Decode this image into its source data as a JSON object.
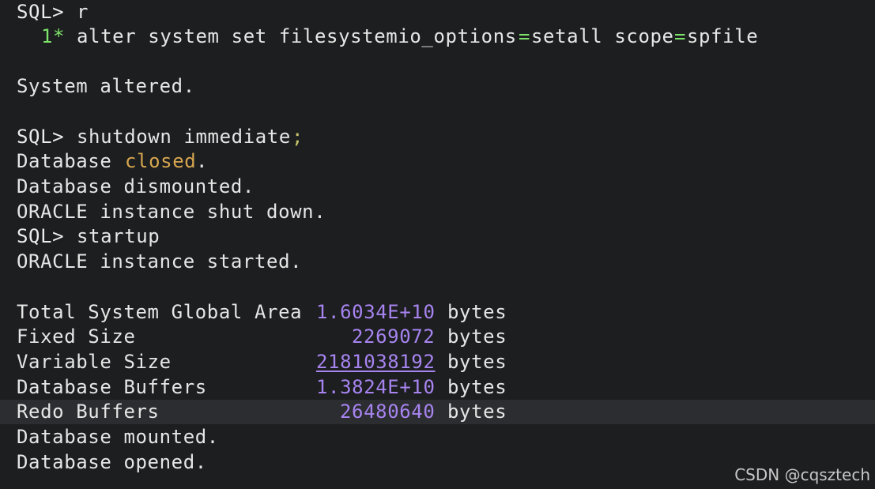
{
  "terminal": {
    "lines": {
      "l1": {
        "prompt": "SQL>",
        "cmd": "r"
      },
      "l2": {
        "num": "1*",
        "a": "alter system set filesystemio_options",
        "eq1": "=",
        "b": "setall scope",
        "eq2": "=",
        "c": "spfile"
      },
      "l3": {
        "text": "System altered."
      },
      "l4": {
        "prompt": "SQL>",
        "cmd": "shutdown immediate",
        "semi": ";"
      },
      "l5": {
        "a": "Database",
        "kw": "closed",
        "b": "."
      },
      "l6": {
        "text": "Database dismounted."
      },
      "l7": {
        "text": "ORACLE instance shut down."
      },
      "l8": {
        "prompt": "SQL>",
        "cmd": "startup"
      },
      "l9": {
        "text": "ORACLE instance started."
      }
    },
    "sga": [
      {
        "label": "Total System Global Area",
        "value": "1.6034E+10",
        "unit": "bytes"
      },
      {
        "label": "Fixed Size",
        "value": "2269072",
        "unit": "bytes"
      },
      {
        "label": "Variable Size",
        "value": "2181038192",
        "unit": "bytes"
      },
      {
        "label": "Database Buffers",
        "value": "1.3824E+10",
        "unit": "bytes"
      },
      {
        "label": "Redo Buffers",
        "value": "26480640",
        "unit": "bytes"
      }
    ],
    "tail": {
      "mounted": "Database mounted.",
      "opened": "Database opened."
    }
  },
  "watermark": "CSDN @cqsztech",
  "colors": {
    "background": "#1c1e1f",
    "text": "#e6e6e6",
    "line_number": "#7ee36a",
    "keyword": "#d8a64f",
    "number": "#a784f0",
    "highlight_row": "#2b2d30"
  }
}
